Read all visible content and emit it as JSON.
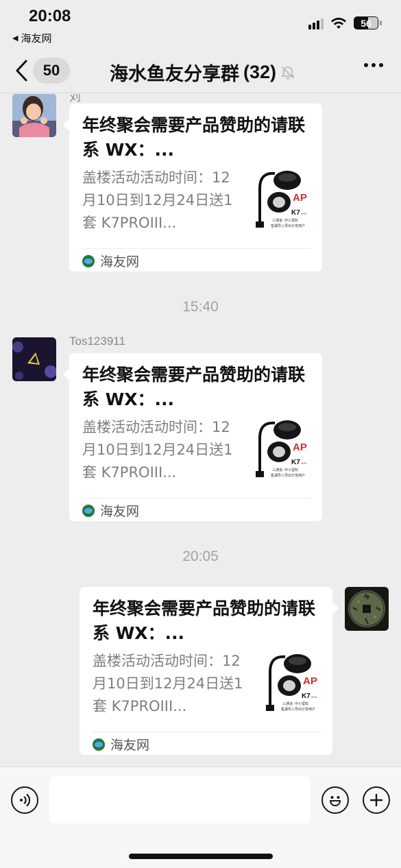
{
  "status_bar": {
    "time": "20:08",
    "back_app": "海友网",
    "battery": "56"
  },
  "nav": {
    "unread_badge": "50",
    "title": "海水鱼友分享群",
    "member_count": "(32)",
    "icons": [
      "chevron-left-icon",
      "mute-bell-icon",
      "more-icon"
    ]
  },
  "messages": [
    {
      "sender": "刘",
      "card": {
        "title": "年终聚会需要产品赞助的请联系 WX：...",
        "desc": "盖楼活动活动时间：12月10日到12月24日送1套 K7PROIII...",
        "source": "海友网",
        "thumb_brand": "AP",
        "thumb_model": "K7",
        "thumb_model_sub": "MINI",
        "thumb_caption_1": "三通道 ·中小型缸",
        "thumb_caption_2": "售漏导入导出分享用户"
      }
    },
    {
      "timestamp": "15:40"
    },
    {
      "sender": "Tos123911",
      "card": {
        "title": "年终聚会需要产品赞助的请联系 WX：...",
        "desc": "盖楼活动活动时间：12月10日到12月24日送1套 K7PROIII...",
        "source": "海友网",
        "thumb_brand": "AP",
        "thumb_model": "K7",
        "thumb_model_sub": "MINI",
        "thumb_caption_1": "三通道 ·中小型缸",
        "thumb_caption_2": "售漏导入导出分享用户"
      }
    },
    {
      "timestamp": "20:05"
    },
    {
      "sender": "",
      "card": {
        "title": "年终聚会需要产品赞助的请联系 WX：...",
        "desc": "盖楼活动活动时间：12月10日到12月24日送1套 K7PROIII...",
        "source": "海友网",
        "thumb_brand": "AP",
        "thumb_model": "K7",
        "thumb_model_sub": "MINI",
        "thumb_caption_1": "三通道 ·中小型缸",
        "thumb_caption_2": "售漏导入导出分享用户"
      }
    }
  ],
  "input_bar": {
    "text_value": "",
    "icons": [
      "voice-icon",
      "emoji-icon",
      "plus-icon"
    ]
  }
}
